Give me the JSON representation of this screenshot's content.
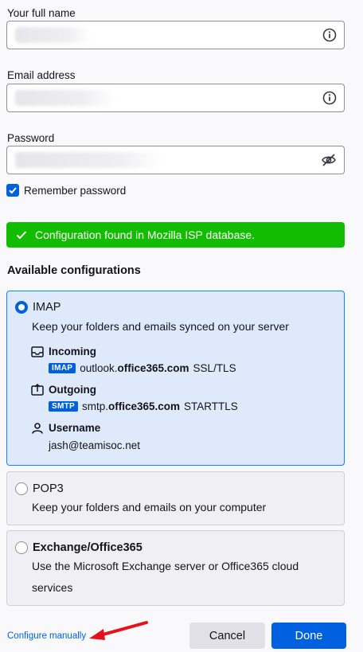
{
  "form": {
    "name_label": "Your full name",
    "email_label": "Email address",
    "password_label": "Password",
    "remember_label": "Remember password",
    "remember_checked": true
  },
  "banner": {
    "text": "Configuration found in Mozilla ISP database.",
    "color": "#12bc00"
  },
  "available": {
    "title": "Available configurations",
    "imap": {
      "title": "IMAP",
      "desc": "Keep your folders and emails synced on your server",
      "incoming_label": "Incoming",
      "incoming_proto": "IMAP",
      "incoming_host_prefix": "outlook.",
      "incoming_host_domain": "office365.com",
      "incoming_security": "SSL/TLS",
      "outgoing_label": "Outgoing",
      "outgoing_proto": "SMTP",
      "outgoing_host_prefix": "smtp.",
      "outgoing_host_domain": "office365.com",
      "outgoing_security": "STARTTLS",
      "username_label": "Username",
      "username_value": "jash@teamisoc.net",
      "selected": true
    },
    "pop3": {
      "title": "POP3",
      "desc": "Keep your folders and emails on your computer"
    },
    "exchange": {
      "title": "Exchange/Office365",
      "desc": "Use the Microsoft Exchange server or Office365 cloud services"
    }
  },
  "footer": {
    "configure_manually": "Configure manually",
    "cancel_label": "Cancel",
    "done_label": "Done"
  },
  "colors": {
    "accent": "#0061e0",
    "selected_card_bg": "#deeafc",
    "annotation_arrow": "#e8101a"
  },
  "icons": {
    "info": "info-icon",
    "hide_password": "eye-slash-icon",
    "check": "checkmark-icon",
    "incoming": "inbox-icon",
    "outgoing": "outbox-icon",
    "user": "user-icon"
  }
}
